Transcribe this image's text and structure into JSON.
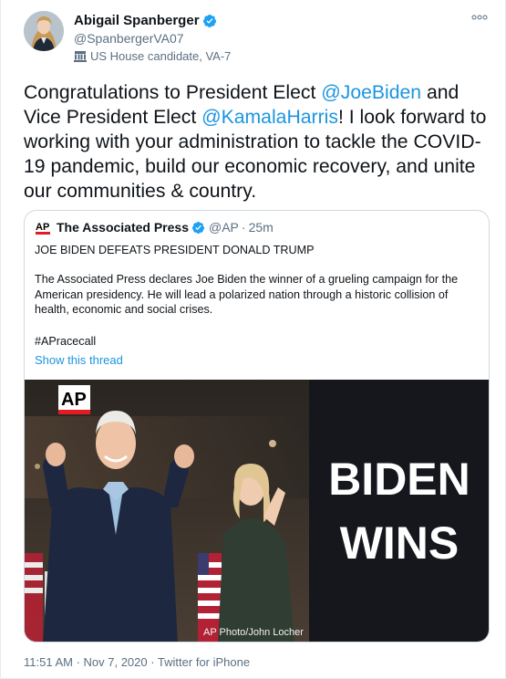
{
  "author": {
    "display_name": "Abigail Spanberger",
    "handle": "@SpanbergerVA07",
    "label": "US House candidate, VA-7"
  },
  "tweet": {
    "segments": [
      {
        "text": "Congratulations to President Elect ",
        "mention": false
      },
      {
        "text": "@JoeBiden",
        "mention": true
      },
      {
        "text": " and Vice President Elect ",
        "mention": false
      },
      {
        "text": "@KamalaHarris",
        "mention": true
      },
      {
        "text": "! I look forward to working with your administration to tackle the COVID-19 pandemic, build our economic recovery, and unite our communities & country.",
        "mention": false
      }
    ]
  },
  "quoted": {
    "logo_text": "AP",
    "display_name": "The Associated Press",
    "handle": "@AP",
    "separator": "·",
    "time": "25m",
    "headline": "JOE BIDEN DEFEATS PRESIDENT DONALD TRUMP",
    "body": "The Associated Press declares Joe Biden the winner of a grueling campaign for the American presidency. He will lead a polarized nation through a historic collision of health, economic and social crises.",
    "hashtag": "#APracecall",
    "show_thread": "Show this thread",
    "media": {
      "logo_text": "AP",
      "headline_line1": "BIDEN",
      "headline_line2": "WINS",
      "credit": "AP Photo/John Locher"
    }
  },
  "footer": {
    "text": "11:51 AM · Nov 7, 2020 · Twitter for iPhone"
  },
  "colors": {
    "accent": "#1b95e0",
    "secondary_text": "#5b7083",
    "verified": "#1da1f2",
    "ap_red": "#e31b23",
    "banner_bg": "#15171c"
  },
  "icons": {
    "verified": "verified-badge-icon",
    "label": "government-building-icon",
    "more": "more-options-icon"
  }
}
